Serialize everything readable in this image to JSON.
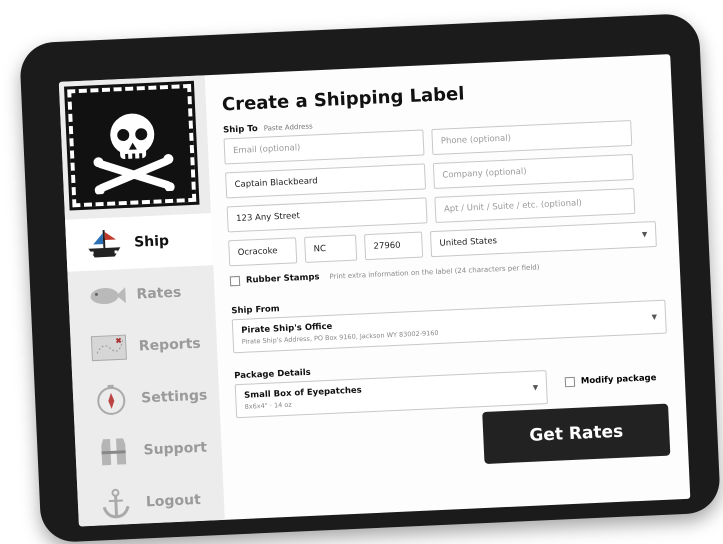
{
  "sidebar": {
    "items": [
      {
        "label": "Ship",
        "icon": "ship-icon",
        "active": true
      },
      {
        "label": "Rates",
        "icon": "fish-icon",
        "active": false
      },
      {
        "label": "Reports",
        "icon": "treasure-map-icon",
        "active": false
      },
      {
        "label": "Settings",
        "icon": "compass-icon",
        "active": false
      },
      {
        "label": "Support",
        "icon": "life-vest-icon",
        "active": false
      },
      {
        "label": "Logout",
        "icon": "anchor-icon",
        "active": false
      }
    ]
  },
  "main": {
    "title": "Create a Shipping Label",
    "ship_to": {
      "label": "Ship To",
      "sub": "Paste Address",
      "email_placeholder": "Email (optional)",
      "phone_placeholder": "Phone (optional)",
      "name": "Captain Blackbeard",
      "company_placeholder": "Company (optional)",
      "street": "123 Any Street",
      "apt_placeholder": "Apt / Unit / Suite / etc. (optional)",
      "city": "Ocracoke",
      "state": "NC",
      "zip": "27960",
      "country": "United States"
    },
    "rubber_stamps": {
      "label": "Rubber Stamps",
      "hint": "Print extra information on the label (24 characters per field)"
    },
    "ship_from": {
      "label": "Ship From",
      "name": "Pirate Ship's Office",
      "address": "Pirate Ship's Address, PO Box 9160, Jackson WY 83002-9160"
    },
    "package": {
      "label": "Package Details",
      "name": "Small Box of Eyepatches",
      "details": "8x6x4\" · 14 oz",
      "modify_label": "Modify package"
    },
    "get_rates_label": "Get Rates"
  }
}
